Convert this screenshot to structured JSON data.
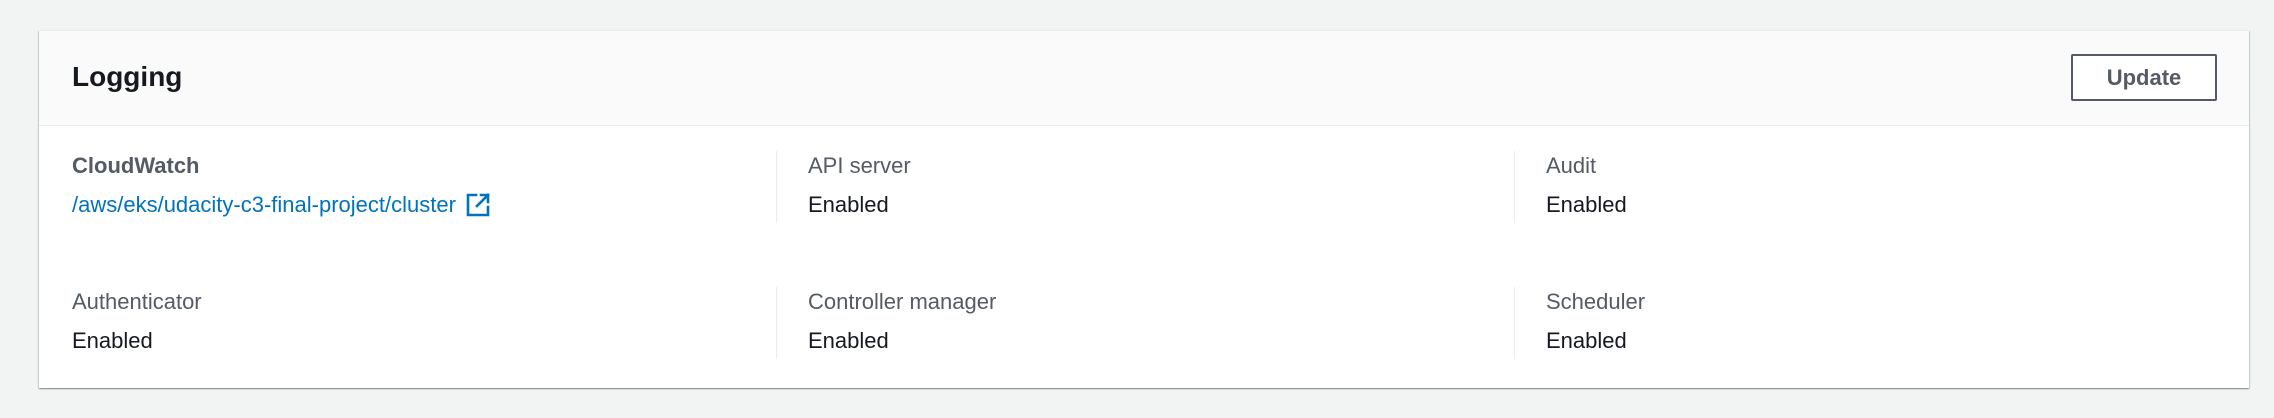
{
  "panel": {
    "title": "Logging",
    "update_label": "Update"
  },
  "fields": {
    "cloudwatch": {
      "label": "CloudWatch",
      "value": "/aws/eks/udacity-c3-final-project/cluster",
      "icon": "external-link-icon"
    },
    "api_server": {
      "label": "API server",
      "value": "Enabled"
    },
    "audit": {
      "label": "Audit",
      "value": "Enabled"
    },
    "authenticator": {
      "label": "Authenticator",
      "value": "Enabled"
    },
    "controller_manager": {
      "label": "Controller manager",
      "value": "Enabled"
    },
    "scheduler": {
      "label": "Scheduler",
      "value": "Enabled"
    }
  },
  "colors": {
    "link": "#0073bb",
    "label": "#545b64",
    "text": "#16191f",
    "background": "#f2f3f3"
  }
}
